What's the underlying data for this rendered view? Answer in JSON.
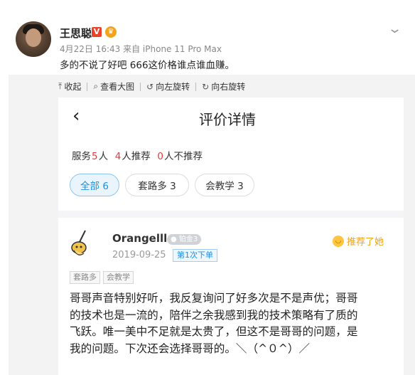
{
  "post": {
    "username": "王思聪",
    "verified_badge": "V",
    "meta": "4月22日 16:43 来自 iPhone 11 Pro Max",
    "text": "多的不说了好吧 666这价格谁点谁血赚。"
  },
  "toolbar": {
    "items": [
      {
        "icon": "collapse-icon",
        "glyph": "⤒",
        "label": "收起"
      },
      {
        "icon": "search-icon",
        "glyph": "⌕",
        "label": "查看大图"
      },
      {
        "icon": "rotate-left-icon",
        "glyph": "↺",
        "label": "向左旋转"
      },
      {
        "icon": "rotate-right-icon",
        "glyph": "↻",
        "label": "向右旋转"
      }
    ]
  },
  "review_page": {
    "back_glyph": "‹",
    "title": "评价详情",
    "stats": {
      "label1": "服务",
      "count1": "5",
      "unit1": "人",
      "count2": "4",
      "label2": "人推荐",
      "count3": "0",
      "label3": "人不推荐"
    },
    "filters": [
      {
        "label": "全部 6",
        "active": true
      },
      {
        "label": "套路多 3",
        "active": false
      },
      {
        "label": "会教学 3",
        "active": false
      }
    ],
    "review": {
      "name": "Orangelll",
      "level": "铂金3",
      "date": "2019-09-25",
      "order_tag": "第1次下单",
      "recommend": "推荐了她",
      "tags": [
        "套路多",
        "会教学"
      ],
      "text_lines": [
        "哥哥声音特别好听，我反复询问了好多次是不是声优；哥哥",
        "的技术也是一流的，陪伴之余我感到我的技术策略有了质的",
        "飞跃。唯一美中不足就是太贵了，但这不是哥哥的问题，是",
        "我的问题。下次还会选择哥哥的。＼（^０^）／"
      ]
    }
  },
  "colors": {
    "accent_red": "#e4393c",
    "accent_blue": "#1d8fe0",
    "recommend_orange": "#f0a21a"
  }
}
